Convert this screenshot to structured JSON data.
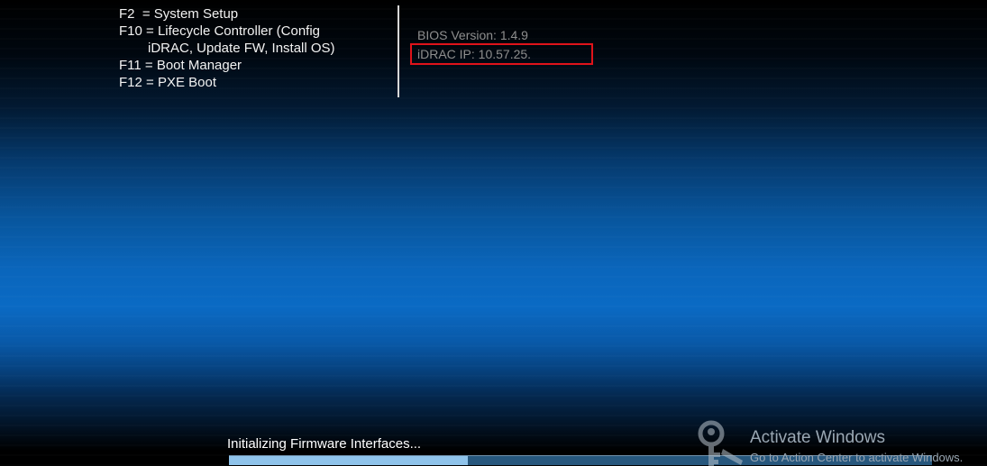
{
  "post_menu": {
    "items": [
      "F2  = System Setup",
      "F10 = Lifecycle Controller (Config",
      "iDRAC, Update FW, Install OS)",
      "F11 = Boot Manager",
      "F12 = PXE Boot"
    ]
  },
  "system_info": {
    "bios_version": "BIOS Version: 1.4.9",
    "idrac_ip": "iDRAC IP:  10.57.25."
  },
  "status": {
    "text": "Initializing Firmware Interfaces...",
    "progress": 0.34
  },
  "watermark": {
    "icon": "key-icon",
    "title": "Activate Windows",
    "subtitle": "Go to Action Center to activate Windows."
  },
  "colors": {
    "highlight_box": "#e0131a",
    "progress_fill": "#8fc3ea",
    "progress_track": "#27577d"
  }
}
